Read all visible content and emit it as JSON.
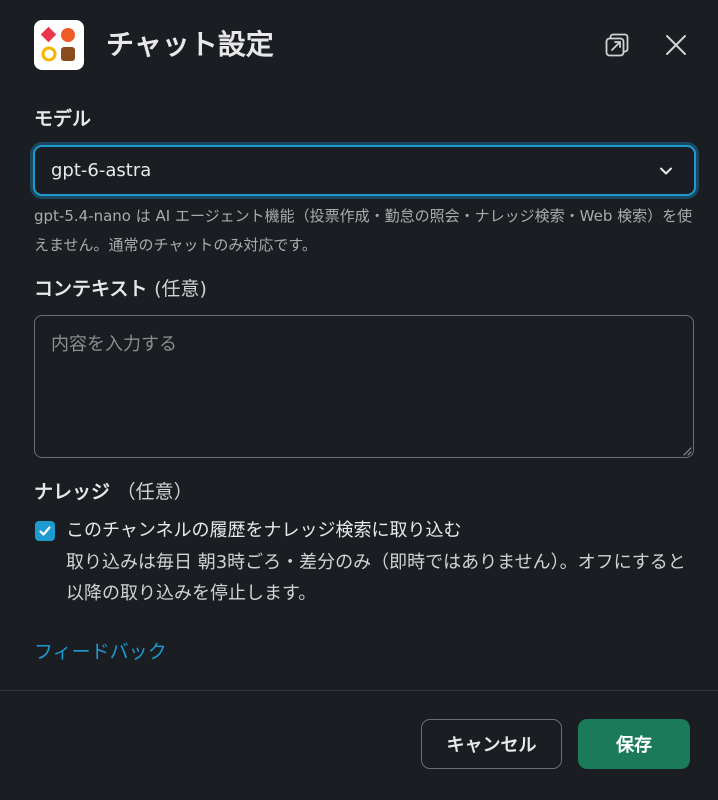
{
  "dialog": {
    "title": "チャット設定",
    "popout_icon": "popout-window-icon",
    "close_icon": "close-icon"
  },
  "model": {
    "label": "モデル",
    "selected": "gpt-6-astra",
    "help_text": "gpt-5.4-nano は AI エージェント機能（投票作成・勤怠の照会・ナレッジ検索・Web 検索）を使えません。通常のチャットのみ対応です。"
  },
  "context": {
    "label": "コンテキスト",
    "optional": "(任意)",
    "placeholder": "内容を入力する",
    "value": ""
  },
  "knowledge": {
    "label": "ナレッジ",
    "optional": "（任意）",
    "checkbox_checked": true,
    "checkbox_label": "このチャンネルの履歴をナレッジ検索に取り込む",
    "checkbox_description": "取り込みは毎日 朝3時ごろ・差分のみ（即時ではありません）。オフにすると以降の取り込みを停止します。"
  },
  "feedback_label": "フィードバック",
  "footer": {
    "cancel_label": "キャンセル",
    "save_label": "保存"
  },
  "colors": {
    "background": "#1a1d21",
    "accent": "#1d9bd1",
    "save": "#1a7a5a"
  }
}
